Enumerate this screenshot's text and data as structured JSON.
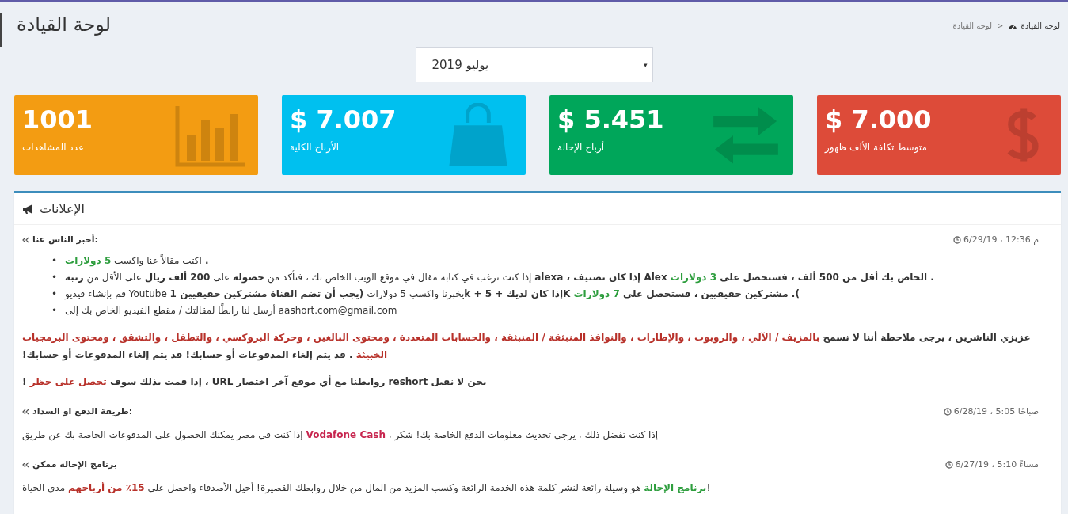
{
  "header": {
    "title": "لوحة القيادة"
  },
  "breadcrumb": {
    "separator": ">",
    "items": [
      {
        "label": "لوحة القيادة",
        "active": false
      },
      {
        "label": "لوحة القيادة",
        "active": true
      }
    ]
  },
  "month_select": {
    "value": "يوليو 2019",
    "caret": "▾"
  },
  "stats": [
    {
      "value": "$ 7.000",
      "label": "متوسط تكلفة الألف ظهور",
      "color": "#dd4b39",
      "kind": "dollar"
    },
    {
      "value": "$ 5.451",
      "label": "أرباح الإحالة",
      "color": "#00a65a",
      "kind": "exchange"
    },
    {
      "value": "$ 7.007",
      "label": "الأرباح الكلية",
      "color": "#00c0ef",
      "kind": "bag"
    },
    {
      "value": "1001",
      "label": "عدد المشاهدات",
      "color": "#f39c12",
      "kind": "chart"
    }
  ],
  "announcements": {
    "title": "الإعلانات",
    "posts": [
      {
        "title": "أخبر الناس عنا:",
        "time": "6/29/19 ، 12:36 م",
        "blocks": [
          {
            "kind": "list",
            "items": [
              {
                "marker": "•",
                "segments": [
                  {
                    "kind": "bold",
                    "text": ". "
                  },
                  {
                    "kind": "plain",
                    "text": "اكتب مقالاً عنا واكسب "
                  },
                  {
                    "kind": "green",
                    "text": "5 دولارات"
                  }
                ]
              },
              {
                "marker": "•",
                "segments": [
                  {
                    "kind": "bold",
                    "text": ". الخاص بك أقل من 500 ألف ، فستحصل على "
                  },
                  {
                    "kind": "green",
                    "text": "3 دولارات"
                  },
                  {
                    "kind": "bold",
                    "text": " Alex إذا كان تصنيف ، alexa"
                  },
                  {
                    "kind": "plain",
                    "text": " إذا كنت ترغب في كتابة مقال في موقع الويب الخاص بك ، فتأكد من "
                  },
                  {
                    "kind": "bold",
                    "text": "حصوله"
                  },
                  {
                    "kind": "plain",
                    "text": " على "
                  },
                  {
                    "kind": "bold",
                    "text": "200 ألف ريال"
                  },
                  {
                    "kind": "plain",
                    "text": " على الأقل من "
                  },
                  {
                    "kind": "bold",
                    "text": "رتبة"
                  }
                ]
              },
              {
                "marker": "•",
                "segments": [
                  {
                    "kind": "bold",
                    "text": "). مشتركين حقيقيين ، فستحصل على "
                  },
                  {
                    "kind": "green",
                    "text": "7 دولارات"
                  },
                  {
                    "kind": "bold",
                    "text": " Kإذا كان لديك + 5 + k"
                  },
                  {
                    "kind": "plain",
                    "text": "يخبرنا واكسب 5 دولارات "
                  },
                  {
                    "kind": "bold",
                    "text": "(يجب أن تضم القناة مشتركين حقيقيين 1"
                  },
                  {
                    "kind": "plain",
                    "text": " Youtube قم بإنشاء فيديو"
                  }
                ]
              },
              {
                "marker": "•",
                "segments": [
                  {
                    "kind": "plain",
                    "text": "aashort.com@gmail.com  أرسل لنا رابطًا لمقالتك / مقطع الفيديو الخاص بك إلى"
                  }
                ]
              }
            ]
          },
          {
            "kind": "paragraph",
            "segments": [
              {
                "kind": "bold",
                "text": "عزيزي الناشرين ، يرجى ملاحظة أننا لا نسمح "
              },
              {
                "kind": "red",
                "text": "بالمزيف / الآلي ، والروبوت ، والإطارات ، والنوافذ المنبثقة / المنبثقة ، والحسابات المتعددة ، ومحتوى البالغين ، وحركة البروكسي ، والتطفل ، والتشقق ، ومحتوى البرمجيات الخبيثة"
              },
              {
                "kind": "bold",
                "text": " . قد يتم إلغاء المدفوعات أو حسابك! قد يتم إلغاء المدفوعات أو حسابك!"
              }
            ]
          },
          {
            "kind": "paragraph",
            "segments": [
              {
                "kind": "bold",
                "text": "نحن لا نقبل reshort روابطنا مع أي موقع آخر اختصار URL ، إذا قمت بذلك سوف "
              },
              {
                "kind": "red",
                "text": "تحصل على حظر"
              },
              {
                "kind": "bold",
                "text": " !"
              }
            ]
          }
        ]
      },
      {
        "title": "طريقة الدفع او السداد:",
        "time": "6/28/19 ، 5:05 صباحًا",
        "blocks": [
          {
            "kind": "paragraph",
            "segments": [
              {
                "kind": "plain",
                "text": "إذا كنت تفضل ذلك ، يرجى تحديث معلومات الدفع الخاصة بك! شكر ، "
              },
              {
                "kind": "crimson",
                "text": "Vodafone Cash"
              },
              {
                "kind": "plain",
                "text": " إذا كنت في مصر يمكنك الحصول على المدفوعات الخاصة بك عن طريق"
              }
            ]
          }
        ]
      },
      {
        "title": "برنامج الإحالة ممكن",
        "time": "6/27/19 ، 5:10 مساءً",
        "blocks": [
          {
            "kind": "paragraph",
            "segments": [
              {
                "kind": "plain",
                "text": "!"
              },
              {
                "kind": "green",
                "text": "برنامج الإحالة"
              },
              {
                "kind": "plain",
                "text": " هو وسيلة رائعة لنشر كلمة هذه الخدمة الرائعة وكسب المزيد من المال من خلال روابطك القصيرة! أحيل الأصدقاء واحصل على "
              },
              {
                "kind": "red",
                "text": "15٪ من أرباحهم"
              },
              {
                "kind": "plain",
                "text": " مدى الحياة"
              }
            ]
          }
        ]
      }
    ]
  }
}
